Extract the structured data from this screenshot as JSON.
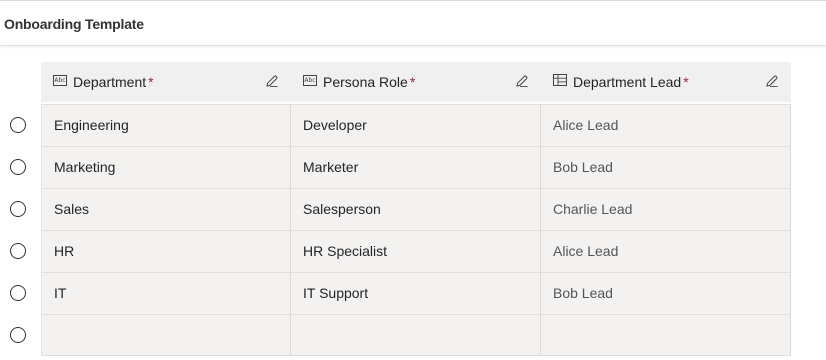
{
  "page": {
    "title": "Onboarding Template"
  },
  "columns": [
    {
      "label": "Department",
      "required_marker": "*",
      "type_icon": "abc-text-icon",
      "type_glyph": "Abc"
    },
    {
      "label": "Persona Role",
      "required_marker": "*",
      "type_icon": "abc-text-icon",
      "type_glyph": "Abc"
    },
    {
      "label": "Department Lead",
      "required_marker": "*",
      "type_icon": "lookup-table-icon",
      "type_glyph": ""
    }
  ],
  "rows": [
    {
      "department": "Engineering",
      "persona_role": "Developer",
      "department_lead": "Alice Lead"
    },
    {
      "department": "Marketing",
      "persona_role": "Marketer",
      "department_lead": "Bob Lead"
    },
    {
      "department": "Sales",
      "persona_role": "Salesperson",
      "department_lead": "Charlie Lead"
    },
    {
      "department": "HR",
      "persona_role": "HR Specialist",
      "department_lead": "Alice Lead"
    },
    {
      "department": "IT",
      "persona_role": "IT Support",
      "department_lead": "Bob Lead"
    },
    {
      "department": "",
      "persona_role": "",
      "department_lead": ""
    }
  ],
  "colors": {
    "required": "#a4262c",
    "cell_bg": "#f3f2f1",
    "header_bg": "#f0f0f0"
  }
}
